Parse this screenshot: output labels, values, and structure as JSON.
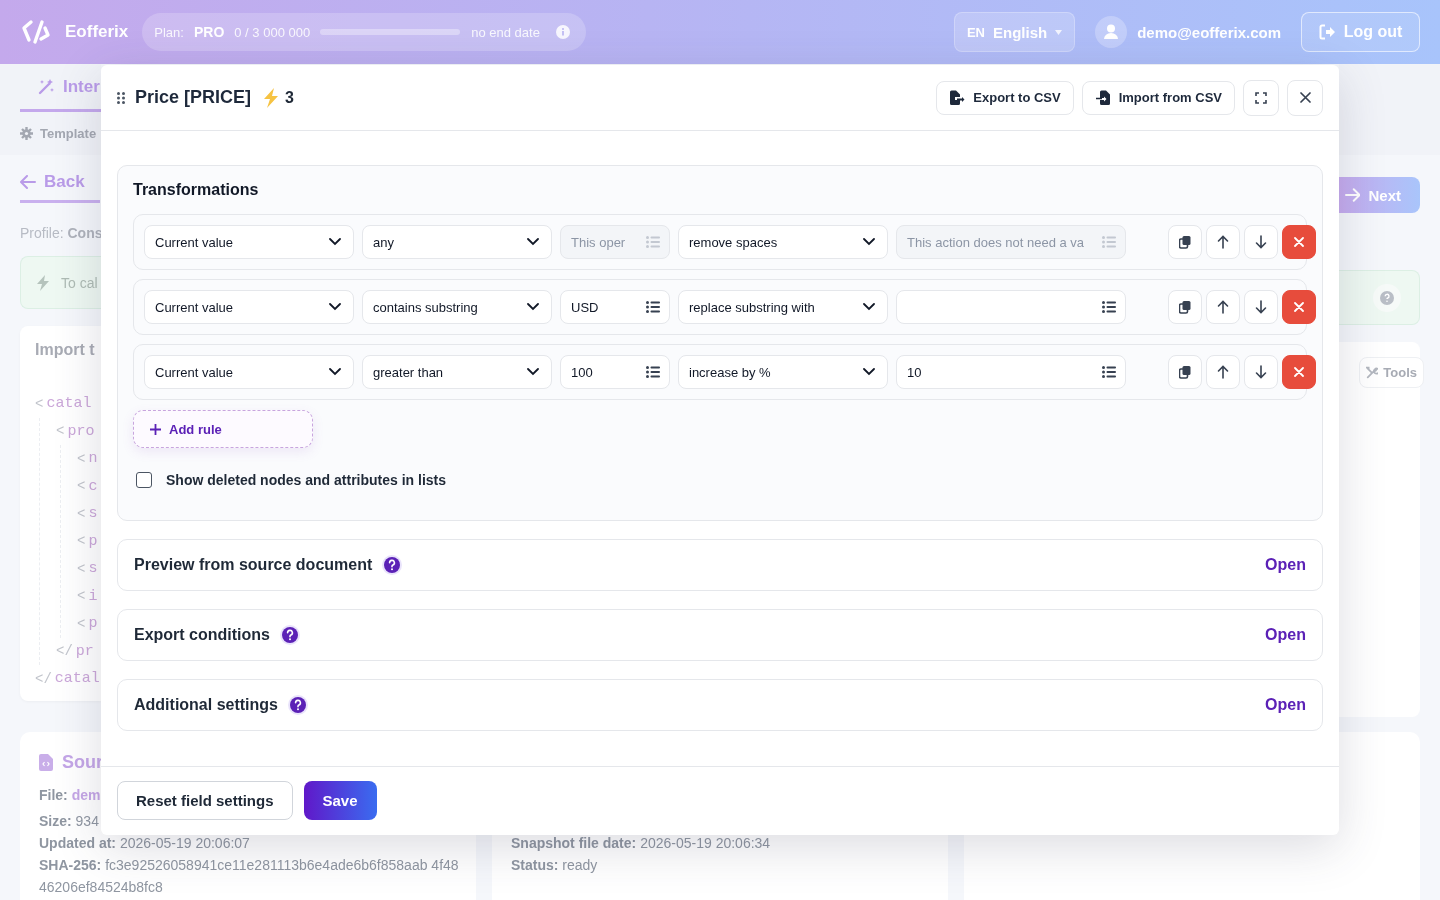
{
  "header": {
    "brand": "Eofferix",
    "plan": {
      "label": "Plan:",
      "name": "PRO",
      "usage": "0 / 3 000 000",
      "level": 0,
      "end": "no end date"
    },
    "language": {
      "code": "EN",
      "name": "English"
    },
    "user": {
      "email": "demo@eofferix.com"
    },
    "logout": "Log out"
  },
  "background": {
    "tabs": [
      {
        "label": "Inter",
        "selected": true
      }
    ],
    "template_link": "Template",
    "back": "Back",
    "profile": "Profile: **Cons**",
    "notice": "To cal",
    "import_card": {
      "title": "Import t",
      "tree": [
        {
          "open": {
            "bracket": "<",
            "tag": "catal"
          },
          "close": {
            "bracket": "</",
            "tag": "catal"
          },
          "children": [
            {
              "open": {
                "bracket": "<",
                "tag": "pro"
              },
              "close": {
                "bracket": "</",
                "tag": "pr"
              },
              "children": [
                {
                  "open": {
                    "bracket": "<",
                    "tag": "n"
                  }
                },
                {
                  "open": {
                    "bracket": "<",
                    "tag": "c"
                  }
                },
                {
                  "open": {
                    "bracket": "<",
                    "tag": "s"
                  }
                },
                {
                  "open": {
                    "bracket": "<",
                    "tag": "p"
                  }
                },
                {
                  "open": {
                    "bracket": "<",
                    "tag": "s"
                  }
                },
                {
                  "open": {
                    "bracket": "<",
                    "tag": "i"
                  }
                },
                {
                  "open": {
                    "bracket": "<",
                    "tag": "p"
                  }
                }
              ]
            }
          ]
        }
      ]
    },
    "next": "Next",
    "tools": "Tools",
    "cards": [
      {
        "title": "Sour",
        "lines": [
          {
            "label": "File:",
            "value": "dem",
            "kind": "link"
          },
          {
            "label": "Size:",
            "value": "934",
            "kind": "text"
          },
          {
            "label": "Updated at:",
            "value": "2026-05-19 20:06:07",
            "kind": "text"
          },
          {
            "text": "**SHA-256:** fc3e92526058941ce11e281113b6e4ade6b6f858aab 4f4846206ef84524b8fc8",
            "kind": "sentence"
          }
        ]
      },
      {
        "lines": [
          {
            "label": "Snapshot file date:",
            "value": "2026-05-19 20:06:34",
            "kind": "text"
          },
          {
            "label": "Status:",
            "value": "ready",
            "kind": "text"
          }
        ]
      },
      {
        "kind": "empty"
      }
    ]
  },
  "modal": {
    "title": "Price [PRICE]",
    "count": "3",
    "buttons": [
      {
        "label": "Export to CSV",
        "kind": "export"
      },
      {
        "label": "Import from CSV",
        "kind": "import"
      }
    ],
    "transformations": {
      "title": "Transformations",
      "rules": [
        {
          "source": "Current value",
          "condition": "any",
          "condition_value": {
            "placeholder": "This oper",
            "disabled": true
          },
          "action": "remove spaces",
          "action_value": {
            "placeholder": "This action does not need a va",
            "disabled": true
          }
        },
        {
          "source": "Current value",
          "condition": "contains substring",
          "condition_value": {
            "value": "USD",
            "disabled": false
          },
          "action": "replace substring with",
          "action_value": {
            "disabled": false
          }
        },
        {
          "source": "Current value",
          "condition": "greater than",
          "condition_value": {
            "value": "100",
            "disabled": false
          },
          "action": "increase by %",
          "action_value": {
            "value": "10",
            "disabled": false
          }
        }
      ],
      "add_rule": "Add rule",
      "show_deleted": {
        "label": "Show deleted nodes and attributes in lists",
        "checked": false
      }
    },
    "sections": [
      {
        "title": "Preview from source document",
        "action": "Open"
      },
      {
        "title": "Export conditions",
        "action": "Open"
      },
      {
        "title": "Additional settings",
        "action": "Open"
      }
    ],
    "footer": [
      {
        "label": "Reset field settings",
        "kind": "secondary"
      },
      {
        "label": "Save",
        "kind": "primary"
      }
    ]
  }
}
